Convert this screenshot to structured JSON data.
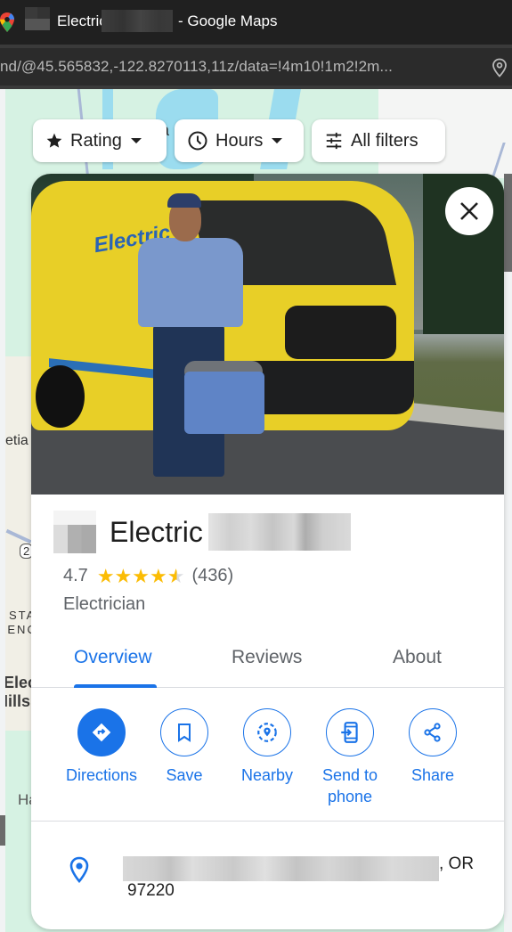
{
  "browser": {
    "title_prefix_redacted": true,
    "title_word": "Electric",
    "title_suffix": "- Google Maps",
    "url": "nd/@45.565832,-122.8270113,11z/data=!4m10!1m2!2m..."
  },
  "map": {
    "labels": [
      "Sa",
      "vetia",
      "STA",
      "RENC",
      "Elec",
      "Hillsb",
      "Ha",
      "2"
    ]
  },
  "filters": [
    {
      "label": "Rating",
      "icon": "star-icon",
      "dropdown": true
    },
    {
      "label": "Hours",
      "icon": "clock-icon",
      "dropdown": true
    },
    {
      "label": "All filters",
      "icon": "sliders-icon",
      "dropdown": false
    }
  ],
  "place": {
    "name_visible": "Electric",
    "name_redacted": true,
    "rating": "4.7",
    "rating_value": 4.7,
    "rating_max": 5,
    "review_count": "(436)",
    "category": "Electrician",
    "hero_van_text": "Electric"
  },
  "tabs": [
    {
      "label": "Overview",
      "active": true
    },
    {
      "label": "Reviews",
      "active": false
    },
    {
      "label": "About",
      "active": false
    }
  ],
  "actions": [
    {
      "label": "Directions",
      "icon": "directions-icon",
      "primary": true
    },
    {
      "label": "Save",
      "icon": "bookmark-icon",
      "primary": false
    },
    {
      "label": "Nearby",
      "icon": "nearby-icon",
      "primary": false
    },
    {
      "label": "Send to phone",
      "icon": "send-to-phone-icon",
      "primary": false
    },
    {
      "label": "Share",
      "icon": "share-icon",
      "primary": false
    }
  ],
  "address": {
    "street_redacted": true,
    "line1_suffix": ", OR",
    "line2": "97220"
  },
  "colors": {
    "accent": "#1a73e8",
    "star": "#fbbc04",
    "text_secondary": "#5f6368"
  }
}
